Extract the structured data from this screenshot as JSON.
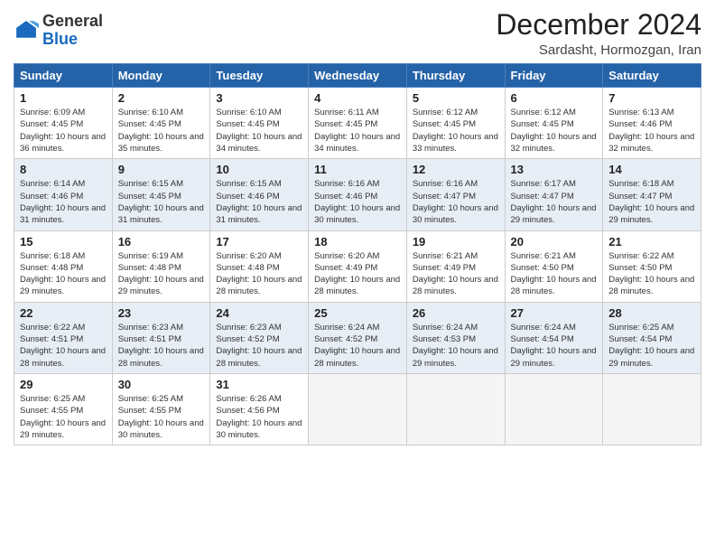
{
  "logo": {
    "general": "General",
    "blue": "Blue"
  },
  "header": {
    "title": "December 2024",
    "subtitle": "Sardasht, Hormozgan, Iran"
  },
  "weekdays": [
    "Sunday",
    "Monday",
    "Tuesday",
    "Wednesday",
    "Thursday",
    "Friday",
    "Saturday"
  ],
  "weeks": [
    [
      {
        "day": "1",
        "sunrise": "6:09 AM",
        "sunset": "4:45 PM",
        "daylight": "10 hours and 36 minutes."
      },
      {
        "day": "2",
        "sunrise": "6:10 AM",
        "sunset": "4:45 PM",
        "daylight": "10 hours and 35 minutes."
      },
      {
        "day": "3",
        "sunrise": "6:10 AM",
        "sunset": "4:45 PM",
        "daylight": "10 hours and 34 minutes."
      },
      {
        "day": "4",
        "sunrise": "6:11 AM",
        "sunset": "4:45 PM",
        "daylight": "10 hours and 34 minutes."
      },
      {
        "day": "5",
        "sunrise": "6:12 AM",
        "sunset": "4:45 PM",
        "daylight": "10 hours and 33 minutes."
      },
      {
        "day": "6",
        "sunrise": "6:12 AM",
        "sunset": "4:45 PM",
        "daylight": "10 hours and 32 minutes."
      },
      {
        "day": "7",
        "sunrise": "6:13 AM",
        "sunset": "4:46 PM",
        "daylight": "10 hours and 32 minutes."
      }
    ],
    [
      {
        "day": "8",
        "sunrise": "6:14 AM",
        "sunset": "4:46 PM",
        "daylight": "10 hours and 31 minutes."
      },
      {
        "day": "9",
        "sunrise": "6:15 AM",
        "sunset": "4:45 PM",
        "daylight": "10 hours and 31 minutes."
      },
      {
        "day": "10",
        "sunrise": "6:15 AM",
        "sunset": "4:46 PM",
        "daylight": "10 hours and 31 minutes."
      },
      {
        "day": "11",
        "sunrise": "6:16 AM",
        "sunset": "4:46 PM",
        "daylight": "10 hours and 30 minutes."
      },
      {
        "day": "12",
        "sunrise": "6:16 AM",
        "sunset": "4:47 PM",
        "daylight": "10 hours and 30 minutes."
      },
      {
        "day": "13",
        "sunrise": "6:17 AM",
        "sunset": "4:47 PM",
        "daylight": "10 hours and 29 minutes."
      },
      {
        "day": "14",
        "sunrise": "6:18 AM",
        "sunset": "4:47 PM",
        "daylight": "10 hours and 29 minutes."
      }
    ],
    [
      {
        "day": "15",
        "sunrise": "6:18 AM",
        "sunset": "4:48 PM",
        "daylight": "10 hours and 29 minutes."
      },
      {
        "day": "16",
        "sunrise": "6:19 AM",
        "sunset": "4:48 PM",
        "daylight": "10 hours and 29 minutes."
      },
      {
        "day": "17",
        "sunrise": "6:20 AM",
        "sunset": "4:48 PM",
        "daylight": "10 hours and 28 minutes."
      },
      {
        "day": "18",
        "sunrise": "6:20 AM",
        "sunset": "4:49 PM",
        "daylight": "10 hours and 28 minutes."
      },
      {
        "day": "19",
        "sunrise": "6:21 AM",
        "sunset": "4:49 PM",
        "daylight": "10 hours and 28 minutes."
      },
      {
        "day": "20",
        "sunrise": "6:21 AM",
        "sunset": "4:50 PM",
        "daylight": "10 hours and 28 minutes."
      },
      {
        "day": "21",
        "sunrise": "6:22 AM",
        "sunset": "4:50 PM",
        "daylight": "10 hours and 28 minutes."
      }
    ],
    [
      {
        "day": "22",
        "sunrise": "6:22 AM",
        "sunset": "4:51 PM",
        "daylight": "10 hours and 28 minutes."
      },
      {
        "day": "23",
        "sunrise": "6:23 AM",
        "sunset": "4:51 PM",
        "daylight": "10 hours and 28 minutes."
      },
      {
        "day": "24",
        "sunrise": "6:23 AM",
        "sunset": "4:52 PM",
        "daylight": "10 hours and 28 minutes."
      },
      {
        "day": "25",
        "sunrise": "6:24 AM",
        "sunset": "4:52 PM",
        "daylight": "10 hours and 28 minutes."
      },
      {
        "day": "26",
        "sunrise": "6:24 AM",
        "sunset": "4:53 PM",
        "daylight": "10 hours and 29 minutes."
      },
      {
        "day": "27",
        "sunrise": "6:24 AM",
        "sunset": "4:54 PM",
        "daylight": "10 hours and 29 minutes."
      },
      {
        "day": "28",
        "sunrise": "6:25 AM",
        "sunset": "4:54 PM",
        "daylight": "10 hours and 29 minutes."
      }
    ],
    [
      {
        "day": "29",
        "sunrise": "6:25 AM",
        "sunset": "4:55 PM",
        "daylight": "10 hours and 29 minutes."
      },
      {
        "day": "30",
        "sunrise": "6:25 AM",
        "sunset": "4:55 PM",
        "daylight": "10 hours and 30 minutes."
      },
      {
        "day": "31",
        "sunrise": "6:26 AM",
        "sunset": "4:56 PM",
        "daylight": "10 hours and 30 minutes."
      },
      null,
      null,
      null,
      null
    ]
  ]
}
